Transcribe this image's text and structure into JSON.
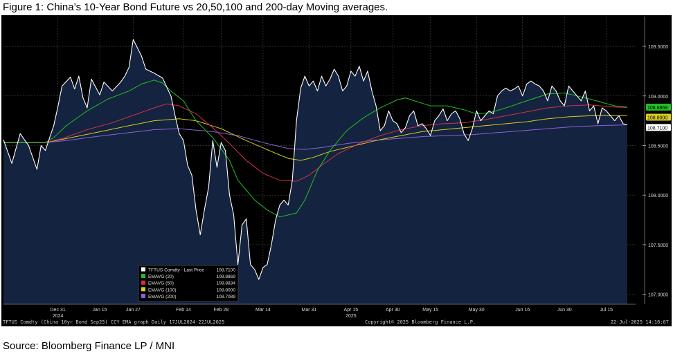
{
  "title": "Figure 1: China’s 10-Year Bond Future vs 20,50,100 and 200-day Moving averages.",
  "source": "Source: Bloomberg Finance LP / MNI",
  "footer": {
    "left": "TFTUS Comdty (China 10yr Bond  Sep25) CCY EMA graph  Daily 17JUL2024-22JUL2025",
    "center": "Copyright© 2025 Bloomberg Finance L.P.",
    "right": "22-Jul-2025 14:16:07"
  },
  "colors": {
    "price": "#ffffff",
    "area_fill": "#14233f",
    "ema20": "#22c022",
    "ema50": "#d4304a",
    "ema100": "#d8cc20",
    "ema200": "#8a62d8"
  },
  "chart_data": {
    "type": "line",
    "title": "",
    "xlabel": "",
    "ylabel": "",
    "ylim": [
      106.9,
      109.8
    ],
    "y_ticks": [
      "107.0000",
      "107.5000",
      "108.0000",
      "108.5000",
      "109.0000",
      "109.5000"
    ],
    "y_tick_values": [
      107.0,
      107.5,
      108.0,
      108.5,
      109.0,
      109.5
    ],
    "x_ticks": [
      "Dec 31",
      "Jan 15",
      "Jan 27",
      "Feb 14",
      "Feb 28",
      "Mar 14",
      "Mar 31",
      "Apr 15",
      "Apr 30",
      "May 15",
      "May 30",
      "Jun 16",
      "Jun 30",
      "Jul 15"
    ],
    "x_tick_index": [
      13,
      23,
      31,
      43,
      52,
      62,
      73,
      83,
      93,
      102,
      113,
      124,
      134,
      144
    ],
    "year_labels": [
      {
        "label": "2024",
        "index": 13
      },
      {
        "label": "2025",
        "index": 83
      }
    ],
    "n_points": 152,
    "series": [
      {
        "name": "TFTUS Comdty - Last Price",
        "key": "price",
        "last": "108.7100",
        "anchors": [
          [
            0,
            108.56
          ],
          [
            2,
            108.32
          ],
          [
            4,
            108.62
          ],
          [
            6,
            108.5
          ],
          [
            8,
            108.26
          ],
          [
            9,
            108.5
          ],
          [
            10,
            108.45
          ],
          [
            12,
            108.7
          ],
          [
            13,
            108.89
          ],
          [
            14,
            109.1
          ],
          [
            16,
            109.19
          ],
          [
            17,
            109.07
          ],
          [
            18,
            109.2
          ],
          [
            19,
            108.98
          ],
          [
            20,
            108.88
          ],
          [
            21,
            109.17
          ],
          [
            23,
            109.01
          ],
          [
            24,
            109.14
          ],
          [
            26,
            109.05
          ],
          [
            28,
            109.14
          ],
          [
            29,
            109.2
          ],
          [
            30,
            109.29
          ],
          [
            31,
            109.57
          ],
          [
            33,
            109.4
          ],
          [
            34,
            109.27
          ],
          [
            36,
            109.23
          ],
          [
            38,
            109.18
          ],
          [
            40,
            109.0
          ],
          [
            41,
            108.8
          ],
          [
            42,
            108.62
          ],
          [
            43,
            108.55
          ],
          [
            44,
            108.3
          ],
          [
            45,
            108.2
          ],
          [
            46,
            107.85
          ],
          [
            47,
            107.6
          ],
          [
            48,
            107.85
          ],
          [
            49,
            108.08
          ],
          [
            50,
            108.55
          ],
          [
            51,
            108.28
          ],
          [
            52,
            108.53
          ],
          [
            53,
            108.45
          ],
          [
            54,
            108.0
          ],
          [
            55,
            107.8
          ],
          [
            56,
            107.3
          ],
          [
            57,
            107.7
          ],
          [
            58,
            107.76
          ],
          [
            59,
            107.3
          ],
          [
            60,
            107.25
          ],
          [
            61,
            107.15
          ],
          [
            62,
            107.27
          ],
          [
            63,
            107.3
          ],
          [
            64,
            107.5
          ],
          [
            65,
            107.75
          ],
          [
            66,
            107.9
          ],
          [
            67,
            107.95
          ],
          [
            68,
            107.9
          ],
          [
            69,
            108.15
          ],
          [
            70,
            108.75
          ],
          [
            71,
            109.08
          ],
          [
            72,
            109.2
          ],
          [
            73,
            109.1
          ],
          [
            74,
            109.15
          ],
          [
            75,
            109.05
          ],
          [
            76,
            109.2
          ],
          [
            77,
            109.1
          ],
          [
            78,
            109.17
          ],
          [
            79,
            109.27
          ],
          [
            80,
            109.2
          ],
          [
            81,
            109.05
          ],
          [
            82,
            109.1
          ],
          [
            83,
            109.25
          ],
          [
            84,
            109.2
          ],
          [
            85,
            109.3
          ],
          [
            86,
            109.15
          ],
          [
            87,
            109.25
          ],
          [
            88,
            109.05
          ],
          [
            89,
            108.9
          ],
          [
            90,
            108.65
          ],
          [
            91,
            108.7
          ],
          [
            92,
            108.85
          ],
          [
            93,
            108.75
          ],
          [
            94,
            108.72
          ],
          [
            95,
            108.63
          ],
          [
            96,
            108.68
          ],
          [
            97,
            108.8
          ],
          [
            98,
            108.85
          ],
          [
            99,
            108.7
          ],
          [
            100,
            108.72
          ],
          [
            101,
            108.67
          ],
          [
            102,
            108.6
          ],
          [
            103,
            108.75
          ],
          [
            104,
            108.8
          ],
          [
            105,
            108.87
          ],
          [
            106,
            108.75
          ],
          [
            107,
            108.82
          ],
          [
            108,
            108.85
          ],
          [
            109,
            108.77
          ],
          [
            110,
            108.62
          ],
          [
            111,
            108.55
          ],
          [
            112,
            108.67
          ],
          [
            113,
            108.85
          ],
          [
            114,
            108.75
          ],
          [
            115,
            108.8
          ],
          [
            116,
            108.85
          ],
          [
            117,
            108.82
          ],
          [
            118,
            109.0
          ],
          [
            119,
            109.05
          ],
          [
            120,
            109.08
          ],
          [
            121,
            109.05
          ],
          [
            122,
            109.07
          ],
          [
            123,
            109.1
          ],
          [
            124,
            109.0
          ],
          [
            125,
            109.12
          ],
          [
            126,
            109.15
          ],
          [
            127,
            109.12
          ],
          [
            128,
            109.1
          ],
          [
            129,
            109.05
          ],
          [
            130,
            108.95
          ],
          [
            131,
            109.1
          ],
          [
            132,
            109.05
          ],
          [
            133,
            108.95
          ],
          [
            134,
            108.9
          ],
          [
            135,
            109.1
          ],
          [
            136,
            109.05
          ],
          [
            137,
            109.0
          ],
          [
            138,
            108.95
          ],
          [
            139,
            109.05
          ],
          [
            140,
            108.85
          ],
          [
            141,
            108.9
          ],
          [
            142,
            108.72
          ],
          [
            143,
            108.88
          ],
          [
            144,
            108.85
          ],
          [
            145,
            108.8
          ],
          [
            146,
            108.75
          ],
          [
            147,
            108.8
          ],
          [
            148,
            108.72
          ],
          [
            149,
            108.71
          ]
        ]
      },
      {
        "name": "EMAVG (20)",
        "key": "ema20",
        "last": "108.8869",
        "anchors": [
          [
            0,
            108.53
          ],
          [
            10,
            108.53
          ],
          [
            12,
            108.58
          ],
          [
            15,
            108.7
          ],
          [
            20,
            108.85
          ],
          [
            25,
            108.97
          ],
          [
            30,
            109.05
          ],
          [
            33,
            109.12
          ],
          [
            36,
            109.16
          ],
          [
            38,
            109.13
          ],
          [
            40,
            109.05
          ],
          [
            43,
            108.95
          ],
          [
            46,
            108.75
          ],
          [
            50,
            108.58
          ],
          [
            54,
            108.35
          ],
          [
            56,
            108.15
          ],
          [
            60,
            107.95
          ],
          [
            63,
            107.85
          ],
          [
            66,
            107.78
          ],
          [
            70,
            107.82
          ],
          [
            72,
            107.95
          ],
          [
            75,
            108.25
          ],
          [
            78,
            108.45
          ],
          [
            82,
            108.65
          ],
          [
            86,
            108.78
          ],
          [
            90,
            108.88
          ],
          [
            94,
            108.96
          ],
          [
            96,
            108.98
          ],
          [
            99,
            108.94
          ],
          [
            102,
            108.9
          ],
          [
            106,
            108.9
          ],
          [
            110,
            108.86
          ],
          [
            113,
            108.82
          ],
          [
            116,
            108.83
          ],
          [
            120,
            108.88
          ],
          [
            125,
            108.95
          ],
          [
            130,
            109.02
          ],
          [
            134,
            109.03
          ],
          [
            137,
            109.0
          ],
          [
            140,
            108.97
          ],
          [
            146,
            108.9
          ],
          [
            149,
            108.887
          ]
        ]
      },
      {
        "name": "EMAVG (50)",
        "key": "ema50",
        "last": "108.8834",
        "anchors": [
          [
            0,
            108.53
          ],
          [
            10,
            108.53
          ],
          [
            14,
            108.57
          ],
          [
            20,
            108.66
          ],
          [
            26,
            108.73
          ],
          [
            32,
            108.82
          ],
          [
            36,
            108.88
          ],
          [
            39,
            108.92
          ],
          [
            42,
            108.9
          ],
          [
            46,
            108.82
          ],
          [
            50,
            108.68
          ],
          [
            54,
            108.52
          ],
          [
            58,
            108.35
          ],
          [
            62,
            108.22
          ],
          [
            66,
            108.15
          ],
          [
            70,
            108.14
          ],
          [
            73,
            108.2
          ],
          [
            76,
            108.3
          ],
          [
            80,
            108.42
          ],
          [
            85,
            108.52
          ],
          [
            90,
            108.6
          ],
          [
            95,
            108.66
          ],
          [
            100,
            108.7
          ],
          [
            105,
            108.72
          ],
          [
            110,
            108.73
          ],
          [
            115,
            108.76
          ],
          [
            120,
            108.8
          ],
          [
            125,
            108.84
          ],
          [
            130,
            108.88
          ],
          [
            135,
            108.9
          ],
          [
            140,
            108.91
          ],
          [
            145,
            108.89
          ],
          [
            149,
            108.883
          ]
        ]
      },
      {
        "name": "EMAVG (100)",
        "key": "ema100",
        "last": "108.8000",
        "anchors": [
          [
            0,
            108.53
          ],
          [
            10,
            108.53
          ],
          [
            15,
            108.57
          ],
          [
            22,
            108.63
          ],
          [
            30,
            108.7
          ],
          [
            36,
            108.75
          ],
          [
            42,
            108.77
          ],
          [
            46,
            108.75
          ],
          [
            52,
            108.67
          ],
          [
            58,
            108.55
          ],
          [
            64,
            108.44
          ],
          [
            68,
            108.37
          ],
          [
            71,
            108.35
          ],
          [
            74,
            108.38
          ],
          [
            78,
            108.44
          ],
          [
            84,
            108.5
          ],
          [
            90,
            108.56
          ],
          [
            95,
            108.6
          ],
          [
            100,
            108.64
          ],
          [
            105,
            108.66
          ],
          [
            110,
            108.68
          ],
          [
            115,
            108.7
          ],
          [
            120,
            108.72
          ],
          [
            125,
            108.74
          ],
          [
            130,
            108.77
          ],
          [
            135,
            108.79
          ],
          [
            140,
            108.8
          ],
          [
            145,
            108.8
          ],
          [
            149,
            108.8
          ]
        ]
      },
      {
        "name": "EMAVG (200)",
        "key": "ema200",
        "last": "108.7089",
        "anchors": [
          [
            0,
            108.53
          ],
          [
            10,
            108.53
          ],
          [
            15,
            108.55
          ],
          [
            22,
            108.59
          ],
          [
            30,
            108.63
          ],
          [
            36,
            108.66
          ],
          [
            42,
            108.67
          ],
          [
            50,
            108.64
          ],
          [
            56,
            108.6
          ],
          [
            62,
            108.53
          ],
          [
            68,
            108.47
          ],
          [
            72,
            108.46
          ],
          [
            76,
            108.48
          ],
          [
            82,
            108.52
          ],
          [
            88,
            108.55
          ],
          [
            94,
            108.57
          ],
          [
            100,
            108.59
          ],
          [
            106,
            108.6
          ],
          [
            112,
            108.61
          ],
          [
            118,
            108.63
          ],
          [
            124,
            108.65
          ],
          [
            130,
            108.67
          ],
          [
            136,
            108.69
          ],
          [
            142,
            108.7
          ],
          [
            149,
            108.709
          ]
        ]
      }
    ],
    "legend": {
      "position": "bottom-center",
      "entries": [
        {
          "label": "TFTUS Comdty - Last Price",
          "value": "108.7100",
          "key": "price"
        },
        {
          "label": "EMAVG (20)",
          "value": "108.8869",
          "key": "ema20"
        },
        {
          "label": "EMAVG (50)",
          "value": "108.8834",
          "key": "ema50"
        },
        {
          "label": "EMAVG (100)",
          "value": "108.8000",
          "key": "ema100"
        },
        {
          "label": "EMAVG (200)",
          "value": "108.7089",
          "key": "ema200"
        }
      ]
    },
    "right_badges": [
      {
        "value": "108.8869",
        "key": "ema20"
      },
      {
        "value": "108.8000",
        "key": "ema100"
      },
      {
        "value": "108.7100",
        "key": "price"
      }
    ],
    "grid": true
  }
}
